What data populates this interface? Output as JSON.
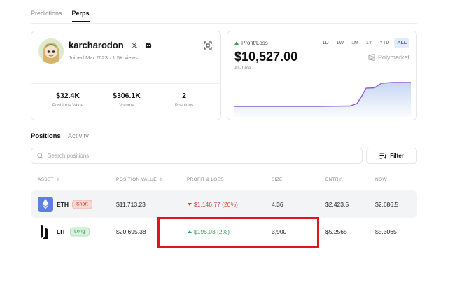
{
  "top_tabs": [
    {
      "label": "Predictions",
      "active": false
    },
    {
      "label": "Perps",
      "active": true
    }
  ],
  "profile": {
    "username": "karcharodon",
    "joined": "Joined Mar 2023",
    "views": "1.5K views",
    "stats": [
      {
        "value": "$32.4K",
        "label": "Positions Value"
      },
      {
        "value": "$306.1K",
        "label": "Volume"
      },
      {
        "value": "2",
        "label": "Positions"
      }
    ]
  },
  "pnl": {
    "label": "Profit/Loss",
    "value": "$10,527.00",
    "period": "All-Time",
    "brand": "Polymarket",
    "ranges": [
      "1D",
      "1W",
      "1M",
      "1Y",
      "YTD",
      "ALL"
    ],
    "active_range": "ALL",
    "line_color": "#8a5cd8",
    "area_color": "#3b6fd6"
  },
  "section_tabs": [
    {
      "label": "Positions",
      "active": true
    },
    {
      "label": "Activity",
      "active": false
    }
  ],
  "search": {
    "placeholder": "Search positions",
    "value": ""
  },
  "filter": {
    "label": "Filter"
  },
  "table": {
    "columns": [
      "ASSET",
      "POSITION VALUE",
      "PROFIT & LOSS",
      "SIZE",
      "ENTRY",
      "NOW"
    ],
    "rows": [
      {
        "ticker": "ETH",
        "side": "Short",
        "position_value": "$11,713.23",
        "pnl": "$1,146.77 (20%)",
        "pnl_direction": "down",
        "size": "4.36",
        "entry": "$2,423.5",
        "now": "$2,686.5"
      },
      {
        "ticker": "LIT",
        "side": "Long",
        "position_value": "$20,695.38",
        "pnl": "$195.03 (2%)",
        "pnl_direction": "up",
        "size": "3,900",
        "entry": "$5.2565",
        "now": "$5.3065"
      }
    ]
  },
  "colors": {
    "accent": "#3b6fd6",
    "positive": "#2e9e5b",
    "negative": "#d63b3b",
    "highlight": "#e0141b"
  }
}
